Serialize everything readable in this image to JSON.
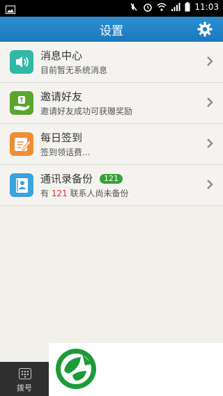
{
  "status": {
    "time": "11:03"
  },
  "header": {
    "title": "设置",
    "settings_icon": "gear-icon"
  },
  "rows": [
    {
      "title": "消息中心",
      "subtitle": "目前暂无系统消息",
      "icon": "speaker-icon",
      "color": "#2fb8a5"
    },
    {
      "title": "邀请好友",
      "subtitle": "邀请好友成功可获赠奖励",
      "icon": "gift-hand-icon",
      "color": "#5aa62c"
    },
    {
      "title": "每日签到",
      "subtitle": "签到领话费...",
      "icon": "signin-icon",
      "color": "#f08d35"
    },
    {
      "title": "通讯录备份",
      "badge": "121",
      "subtitle_prefix": "有 ",
      "subtitle_count": "121",
      "subtitle_suffix": " 联系人尚未备份",
      "icon": "contacts-book-icon",
      "color": "#3aa2de"
    }
  ],
  "bottom": {
    "dial_label": "拨号"
  }
}
